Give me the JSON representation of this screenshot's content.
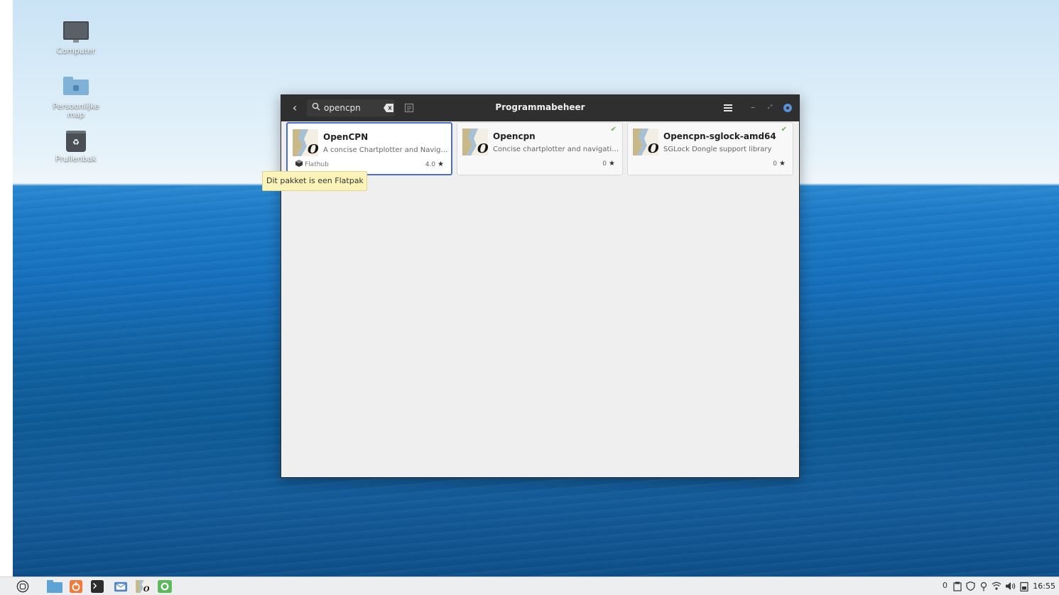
{
  "desktop": {
    "icons": [
      {
        "label": "Computer"
      },
      {
        "label": "Persoonlijke map"
      },
      {
        "label": "Prullenbak"
      }
    ]
  },
  "window": {
    "title": "Programmabeheer",
    "search": {
      "value": "opencpn",
      "placeholder": ""
    },
    "results": [
      {
        "name": "OpenCPN",
        "description": "A concise Chartplotter and Navig…",
        "source": "Flathub",
        "rating": "4.0",
        "installed": false,
        "selected": true
      },
      {
        "name": "Opencpn",
        "description": "Concise chartplotter and navigati…",
        "source": "",
        "rating": "0",
        "installed": true,
        "selected": false
      },
      {
        "name": "Opencpn-sglock-amd64",
        "description": "SGLock Dongle support library",
        "source": "",
        "rating": "0",
        "installed": true,
        "selected": false
      }
    ],
    "tooltip": "Dit pakket is een Flatpak"
  },
  "taskbar": {
    "clock": "16:55",
    "tray_badge": "0"
  },
  "colors": {
    "accent": "#4a6ed0",
    "titlebar": "#2f2f2f",
    "installed_check": "#6cb14a",
    "tooltip_bg": "#fcf3b8"
  }
}
